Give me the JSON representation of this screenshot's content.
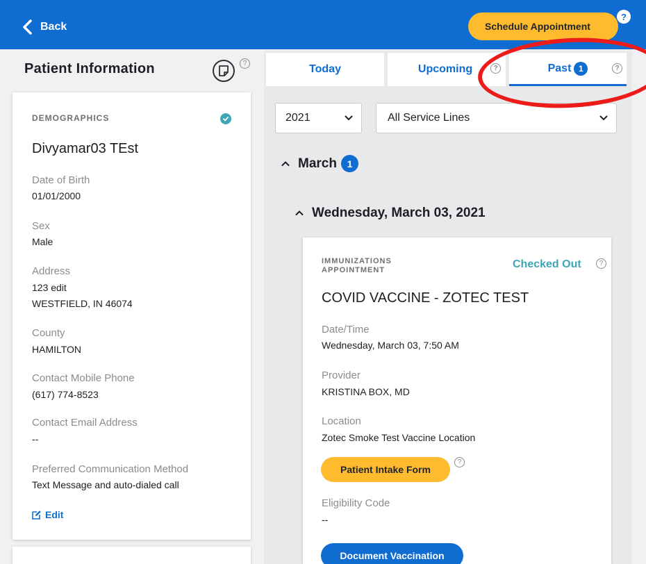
{
  "header": {
    "back_label": "Back",
    "schedule_label": "Schedule Appointment",
    "help_glyph": "?"
  },
  "left": {
    "title": "Patient Information",
    "help_glyph": "?",
    "demographics": {
      "heading": "DEMOGRAPHICS",
      "name": "Divyamar03 TEst",
      "dob_label": "Date of Birth",
      "dob": "01/01/2000",
      "sex_label": "Sex",
      "sex": "Male",
      "address_label": "Address",
      "address_line1": "123 edit",
      "address_line2": "WESTFIELD, IN 46074",
      "county_label": "County",
      "county": "HAMILTON",
      "phone_label": "Contact Mobile Phone",
      "phone": "(617) 774-8523",
      "email_label": "Contact Email Address",
      "email": "--",
      "pref_label": "Preferred Communication Method",
      "pref": "Text Message and auto-dialed call",
      "edit_label": "Edit"
    }
  },
  "tabs": [
    {
      "label": "Today"
    },
    {
      "label": "Upcoming",
      "help": "?"
    },
    {
      "label": "Past",
      "count": "1",
      "help": "?"
    }
  ],
  "filters": {
    "year": "2021",
    "service": "All Service Lines"
  },
  "month": {
    "label": "March",
    "count": "1"
  },
  "day": {
    "label": "Wednesday, March 03, 2021"
  },
  "appointment": {
    "type": "IMMUNIZATIONS APPOINTMENT",
    "status": "Checked Out",
    "title": "COVID VACCINE - ZOTEC TEST",
    "datetime_label": "Date/Time",
    "datetime": "Wednesday, March 03, 7:50 AM",
    "provider_label": "Provider",
    "provider": "KRISTINA BOX, MD",
    "location_label": "Location",
    "location": "Zotec Smoke Test Vaccine Location",
    "intake_label": "Patient Intake Form",
    "eligibility_label": "Eligibility Code",
    "eligibility": "--",
    "document_label": "Document Vaccination"
  },
  "colors": {
    "brand_blue": "#0f6dd1",
    "accent_yellow": "#fdbb2d",
    "status_teal": "#3ea7b5",
    "annotation_red": "#ee1b1b"
  }
}
